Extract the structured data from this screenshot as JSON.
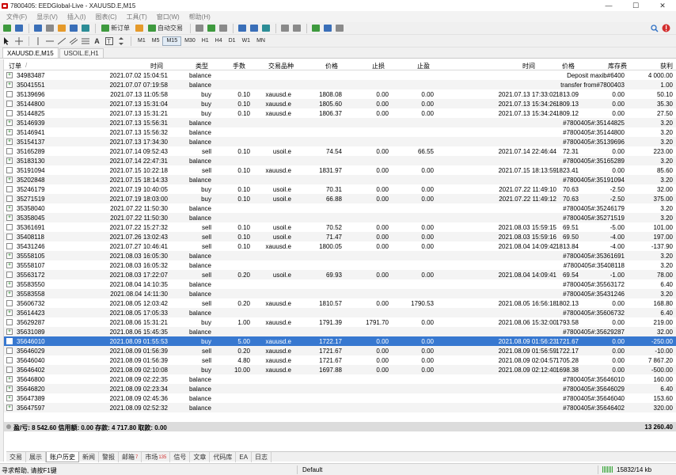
{
  "window": {
    "title": "7800405: EEDGlobal-Live - XAUUSD.E,M15",
    "buttons": [
      "—",
      "☐",
      "✕"
    ]
  },
  "menu": [
    "文件(F)",
    "显示(V)",
    "插入(I)",
    "图表(C)",
    "工具(T)",
    "窗口(W)",
    "帮助(H)"
  ],
  "toolbar": {
    "new_order": "新订单",
    "auto_trading": "自动交易",
    "timeframes": [
      "M1",
      "M5",
      "M15",
      "M30",
      "H1",
      "H4",
      "D1",
      "W1",
      "MN"
    ]
  },
  "chart_tabs": [
    "XAUUSD.E,M15",
    "USOIL.E,H1"
  ],
  "columns": {
    "order": "订单",
    "order_sort": "/",
    "time": "时间",
    "type": "类型",
    "lots": "手数",
    "symbol": "交易品种",
    "price": "价格",
    "sl": "止损",
    "tp": "止盈",
    "close_time": "时间",
    "close_price": "价格",
    "swap": "库存费",
    "profit": "获利"
  },
  "rows": [
    {
      "order": "34983487",
      "time": "2021.07.02 15:04:51",
      "type": "balance",
      "lots": "",
      "symbol": "",
      "price": "",
      "sl": "",
      "tp": "",
      "ctime": "",
      "cprice": "",
      "swap": "Deposit maxib#6400",
      "profit": "4 000.00"
    },
    {
      "order": "35041551",
      "time": "2021.07.07 07:19:58",
      "type": "balance",
      "lots": "",
      "symbol": "",
      "price": "",
      "sl": "",
      "tp": "",
      "ctime": "",
      "cprice": "",
      "swap": "transfer from#7800403",
      "profit": "1.00"
    },
    {
      "order": "35139696",
      "time": "2021.07.13 11:05:58",
      "type": "buy",
      "lots": "0.10",
      "symbol": "xauusd.e",
      "price": "1808.08",
      "sl": "0.00",
      "tp": "0.00",
      "ctime": "2021.07.13 17:33:02",
      "cprice": "1813.09",
      "swap": "0.00",
      "profit": "50.10"
    },
    {
      "order": "35144800",
      "time": "2021.07.13 15:31:04",
      "type": "buy",
      "lots": "0.10",
      "symbol": "xauusd.e",
      "price": "1805.60",
      "sl": "0.00",
      "tp": "0.00",
      "ctime": "2021.07.13 15:34:26",
      "cprice": "1809.13",
      "swap": "0.00",
      "profit": "35.30"
    },
    {
      "order": "35144825",
      "time": "2021.07.13 15:31:21",
      "type": "buy",
      "lots": "0.10",
      "symbol": "xauusd.e",
      "price": "1806.37",
      "sl": "0.00",
      "tp": "0.00",
      "ctime": "2021.07.13 15:34:24",
      "cprice": "1809.12",
      "swap": "0.00",
      "profit": "27.50"
    },
    {
      "order": "35146939",
      "time": "2021.07.13 15:56:31",
      "type": "balance",
      "lots": "",
      "symbol": "",
      "price": "",
      "sl": "",
      "tp": "",
      "ctime": "",
      "cprice": "",
      "swap": "#7800405#:35144825",
      "profit": "3.20"
    },
    {
      "order": "35146941",
      "time": "2021.07.13 15:56:32",
      "type": "balance",
      "lots": "",
      "symbol": "",
      "price": "",
      "sl": "",
      "tp": "",
      "ctime": "",
      "cprice": "",
      "swap": "#7800405#:35144800",
      "profit": "3.20"
    },
    {
      "order": "35154137",
      "time": "2021.07.13 17:34:30",
      "type": "balance",
      "lots": "",
      "symbol": "",
      "price": "",
      "sl": "",
      "tp": "",
      "ctime": "",
      "cprice": "",
      "swap": "#7800405#:35139696",
      "profit": "3.20"
    },
    {
      "order": "35165289",
      "time": "2021.07.14 09:52:43",
      "type": "sell",
      "lots": "0.10",
      "symbol": "usoil.e",
      "price": "74.54",
      "sl": "0.00",
      "tp": "66.55",
      "ctime": "2021.07.14 22:46:44",
      "cprice": "72.31",
      "swap": "0.00",
      "profit": "223.00"
    },
    {
      "order": "35183130",
      "time": "2021.07.14 22:47:31",
      "type": "balance",
      "lots": "",
      "symbol": "",
      "price": "",
      "sl": "",
      "tp": "",
      "ctime": "",
      "cprice": "",
      "swap": "#7800405#:35165289",
      "profit": "3.20"
    },
    {
      "order": "35191094",
      "time": "2021.07.15 10:22:18",
      "type": "sell",
      "lots": "0.10",
      "symbol": "xauusd.e",
      "price": "1831.97",
      "sl": "0.00",
      "tp": "0.00",
      "ctime": "2021.07.15 18:13:59",
      "cprice": "1823.41",
      "swap": "0.00",
      "profit": "85.60"
    },
    {
      "order": "35202848",
      "time": "2021.07.15 18:14:33",
      "type": "balance",
      "lots": "",
      "symbol": "",
      "price": "",
      "sl": "",
      "tp": "",
      "ctime": "",
      "cprice": "",
      "swap": "#7800405#:35191094",
      "profit": "3.20"
    },
    {
      "order": "35246179",
      "time": "2021.07.19 10:40:05",
      "type": "buy",
      "lots": "0.10",
      "symbol": "usoil.e",
      "price": "70.31",
      "sl": "0.00",
      "tp": "0.00",
      "ctime": "2021.07.22 11:49:10",
      "cprice": "70.63",
      "swap": "-2.50",
      "profit": "32.00"
    },
    {
      "order": "35271519",
      "time": "2021.07.19 18:03:00",
      "type": "buy",
      "lots": "0.10",
      "symbol": "usoil.e",
      "price": "66.88",
      "sl": "0.00",
      "tp": "0.00",
      "ctime": "2021.07.22 11:49:12",
      "cprice": "70.63",
      "swap": "-2.50",
      "profit": "375.00"
    },
    {
      "order": "35358040",
      "time": "2021.07.22 11:50:30",
      "type": "balance",
      "lots": "",
      "symbol": "",
      "price": "",
      "sl": "",
      "tp": "",
      "ctime": "",
      "cprice": "",
      "swap": "#7800405#:35246179",
      "profit": "3.20"
    },
    {
      "order": "35358045",
      "time": "2021.07.22 11:50:30",
      "type": "balance",
      "lots": "",
      "symbol": "",
      "price": "",
      "sl": "",
      "tp": "",
      "ctime": "",
      "cprice": "",
      "swap": "#7800405#:35271519",
      "profit": "3.20"
    },
    {
      "order": "35361691",
      "time": "2021.07.22 15:27:32",
      "type": "sell",
      "lots": "0.10",
      "symbol": "usoil.e",
      "price": "70.52",
      "sl": "0.00",
      "tp": "0.00",
      "ctime": "2021.08.03 15:59:15",
      "cprice": "69.51",
      "swap": "-5.00",
      "profit": "101.00"
    },
    {
      "order": "35408118",
      "time": "2021.07.26 13:02:43",
      "type": "sell",
      "lots": "0.10",
      "symbol": "usoil.e",
      "price": "71.47",
      "sl": "0.00",
      "tp": "0.00",
      "ctime": "2021.08.03 15:59:16",
      "cprice": "69.50",
      "swap": "-4.00",
      "profit": "197.00"
    },
    {
      "order": "35431246",
      "time": "2021.07.27 10:46:41",
      "type": "sell",
      "lots": "0.10",
      "symbol": "xauusd.e",
      "price": "1800.05",
      "sl": "0.00",
      "tp": "0.00",
      "ctime": "2021.08.04 14:09:42",
      "cprice": "1813.84",
      "swap": "-4.00",
      "profit": "-137.90"
    },
    {
      "order": "35558105",
      "time": "2021.08.03 16:05:30",
      "type": "balance",
      "lots": "",
      "symbol": "",
      "price": "",
      "sl": "",
      "tp": "",
      "ctime": "",
      "cprice": "",
      "swap": "#7800405#:35361691",
      "profit": "3.20"
    },
    {
      "order": "35558107",
      "time": "2021.08.03 16:05:32",
      "type": "balance",
      "lots": "",
      "symbol": "",
      "price": "",
      "sl": "",
      "tp": "",
      "ctime": "",
      "cprice": "",
      "swap": "#7800405#:35408118",
      "profit": "3.20"
    },
    {
      "order": "35563172",
      "time": "2021.08.03 17:22:07",
      "type": "sell",
      "lots": "0.20",
      "symbol": "usoil.e",
      "price": "69.93",
      "sl": "0.00",
      "tp": "0.00",
      "ctime": "2021.08.04 14:09:41",
      "cprice": "69.54",
      "swap": "-1.00",
      "profit": "78.00"
    },
    {
      "order": "35583550",
      "time": "2021.08.04 14:10:35",
      "type": "balance",
      "lots": "",
      "symbol": "",
      "price": "",
      "sl": "",
      "tp": "",
      "ctime": "",
      "cprice": "",
      "swap": "#7800405#:35563172",
      "profit": "6.40"
    },
    {
      "order": "35583558",
      "time": "2021.08.04 14:11:30",
      "type": "balance",
      "lots": "",
      "symbol": "",
      "price": "",
      "sl": "",
      "tp": "",
      "ctime": "",
      "cprice": "",
      "swap": "#7800405#:35431246",
      "profit": "3.20"
    },
    {
      "order": "35606732",
      "time": "2021.08.05 12:03:42",
      "type": "sell",
      "lots": "0.20",
      "symbol": "xauusd.e",
      "price": "1810.57",
      "sl": "0.00",
      "tp": "1790.53",
      "ctime": "2021.08.05 16:56:18",
      "cprice": "1802.13",
      "swap": "0.00",
      "profit": "168.80"
    },
    {
      "order": "35614423",
      "time": "2021.08.05 17:05:33",
      "type": "balance",
      "lots": "",
      "symbol": "",
      "price": "",
      "sl": "",
      "tp": "",
      "ctime": "",
      "cprice": "",
      "swap": "#7800405#:35606732",
      "profit": "6.40"
    },
    {
      "order": "35629287",
      "time": "2021.08.06 15:31:21",
      "type": "buy",
      "lots": "1.00",
      "symbol": "xauusd.e",
      "price": "1791.39",
      "sl": "1791.70",
      "tp": "0.00",
      "ctime": "2021.08.06 15:32:00",
      "cprice": "1793.58",
      "swap": "0.00",
      "profit": "219.00"
    },
    {
      "order": "35631089",
      "time": "2021.08.06 15:45:35",
      "type": "balance",
      "lots": "",
      "symbol": "",
      "price": "",
      "sl": "",
      "tp": "",
      "ctime": "",
      "cprice": "",
      "swap": "#7800405#:35629287",
      "profit": "32.00"
    },
    {
      "order": "35646010",
      "time": "2021.08.09 01:55:53",
      "type": "buy",
      "lots": "5.00",
      "symbol": "xauusd.e",
      "price": "1722.17",
      "sl": "0.00",
      "tp": "0.00",
      "ctime": "2021.08.09 01:56:23",
      "cprice": "1721.67",
      "swap": "0.00",
      "profit": "-250.00",
      "selected": true
    },
    {
      "order": "35646029",
      "time": "2021.08.09 01:56:39",
      "type": "sell",
      "lots": "0.20",
      "symbol": "xauusd.e",
      "price": "1721.67",
      "sl": "0.00",
      "tp": "0.00",
      "ctime": "2021.08.09 01:56:59",
      "cprice": "1722.17",
      "swap": "0.00",
      "profit": "-10.00"
    },
    {
      "order": "35646040",
      "time": "2021.08.09 01:56:39",
      "type": "sell",
      "lots": "4.80",
      "symbol": "xauusd.e",
      "price": "1721.67",
      "sl": "0.00",
      "tp": "0.00",
      "ctime": "2021.08.09 02:04:57",
      "cprice": "1705.28",
      "swap": "0.00",
      "profit": "7 867.20"
    },
    {
      "order": "35646402",
      "time": "2021.08.09 02:10:08",
      "type": "buy",
      "lots": "10.00",
      "symbol": "xauusd.e",
      "price": "1697.88",
      "sl": "0.00",
      "tp": "0.00",
      "ctime": "2021.08.09 02:12:40",
      "cprice": "1698.38",
      "swap": "0.00",
      "profit": "-500.00"
    },
    {
      "order": "35646800",
      "time": "2021.08.09 02:22:35",
      "type": "balance",
      "lots": "",
      "symbol": "",
      "price": "",
      "sl": "",
      "tp": "",
      "ctime": "",
      "cprice": "",
      "swap": "#7800405#:35646010",
      "profit": "160.00"
    },
    {
      "order": "35646820",
      "time": "2021.08.09 02:23:34",
      "type": "balance",
      "lots": "",
      "symbol": "",
      "price": "",
      "sl": "",
      "tp": "",
      "ctime": "",
      "cprice": "",
      "swap": "#7800405#:35646029",
      "profit": "6.40"
    },
    {
      "order": "35647389",
      "time": "2021.08.09 02:45:36",
      "type": "balance",
      "lots": "",
      "symbol": "",
      "price": "",
      "sl": "",
      "tp": "",
      "ctime": "",
      "cprice": "",
      "swap": "#7800405#:35646040",
      "profit": "153.60"
    },
    {
      "order": "35647597",
      "time": "2021.08.09 02:52:32",
      "type": "balance",
      "lots": "",
      "symbol": "",
      "price": "",
      "sl": "",
      "tp": "",
      "ctime": "",
      "cprice": "",
      "swap": "#7800405#:35646402",
      "profit": "320.00"
    }
  ],
  "summary": {
    "text": "盈/亏: 8 542.60  信用额: 0.00  存款: 4 717.80  取款: 0.00",
    "total": "13 260.40"
  },
  "bottom_tabs": [
    {
      "label": "交易"
    },
    {
      "label": "展示"
    },
    {
      "label": "账户历史",
      "active": true
    },
    {
      "label": "新闻"
    },
    {
      "label": "警报"
    },
    {
      "label": "邮箱",
      "count": "7"
    },
    {
      "label": "市场",
      "count": "135"
    },
    {
      "label": "信号"
    },
    {
      "label": "文章"
    },
    {
      "label": "代码库"
    },
    {
      "label": "EA"
    },
    {
      "label": "日志"
    }
  ],
  "status": {
    "help": "寻求帮助, 请按F1键",
    "profile": "Default",
    "traffic": "15832/14 kb"
  }
}
